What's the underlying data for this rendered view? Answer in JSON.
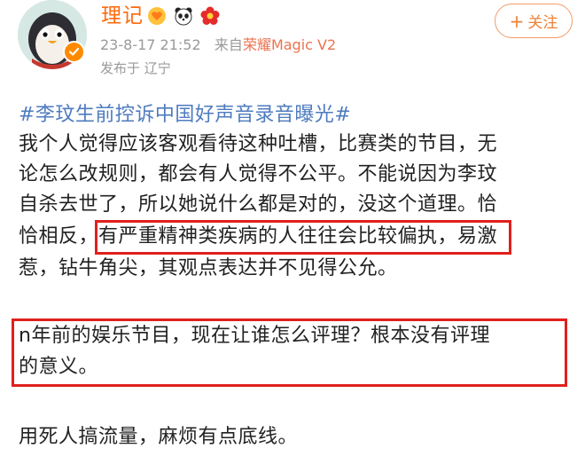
{
  "user": {
    "name": "理记",
    "badges": [
      "hand-heart-badge",
      "panda-badge",
      "red-flower-badge"
    ],
    "verified_color": "#ff8a00"
  },
  "meta": {
    "timestamp": "23-8-17 21:52",
    "source_prefix": "来自",
    "device": "荣耀Magic V2",
    "location": "发布于 辽宁"
  },
  "follow": {
    "plus": "+",
    "label": "关注"
  },
  "post": {
    "hashtag": "#李玟生前控诉中国好声音录音曝光#",
    "para1_lines": [
      "我个人觉得应该客观看待这种吐槽，比赛类的节目，无",
      "论怎么改规则，都会有人觉得不公平。不能说因为李玟",
      "自杀去世了，所以她说什么都是对的，没这个道理。恰",
      "恰相反，有严重精神类疾病的人往往会比较偏执，易激",
      "惹，钻牛角尖，其观点表达并不见得公允。"
    ],
    "para2_lines": [
      "n年前的娱乐节目，现在让谁怎么评理？根本没有评理",
      "的意义。"
    ],
    "para3": "用死人搞流量，麻烦有点底线。"
  },
  "colors": {
    "username": "#ff6a0d",
    "hashtag": "#4e7bbf",
    "highlight": "#e0201c",
    "follow": "#f08036"
  }
}
